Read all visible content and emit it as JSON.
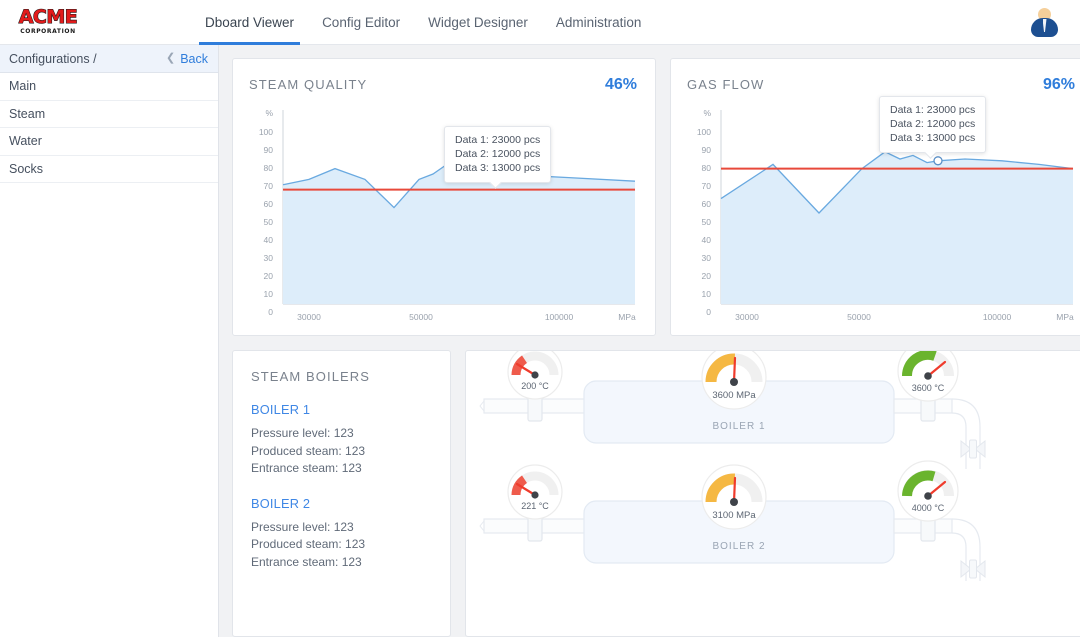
{
  "header": {
    "logo": {
      "brand": "ACME",
      "sub": "CORPORATION",
      "icon": "acme-logo-icon"
    },
    "nav": [
      {
        "label": "Dboard Viewer",
        "active": true
      },
      {
        "label": "Config Editor",
        "active": false
      },
      {
        "label": "Widget Designer",
        "active": false
      },
      {
        "label": "Administration",
        "active": false
      }
    ],
    "avatar_icon": "user-avatar-icon"
  },
  "sidebar": {
    "title": "Configurations /",
    "back_label": "Back",
    "back_icon": "chevron-left-icon",
    "items": [
      {
        "label": "Main"
      },
      {
        "label": "Steam"
      },
      {
        "label": "Water"
      },
      {
        "label": "Socks"
      }
    ]
  },
  "charts": [
    {
      "title": "STEAM QUALITY",
      "badge": "46%",
      "tooltip": [
        "Data 1: 23000 pcs",
        "Data 2: 12000 pcs",
        "Data 3: 13000 pcs"
      ]
    },
    {
      "title": "GAS FLOW",
      "badge": "96%",
      "tooltip": [
        "Data 1: 23000 pcs",
        "Data 2: 12000 pcs",
        "Data 3: 13000 pcs"
      ]
    }
  ],
  "boilers_panel": {
    "title": "STEAM BOILERS",
    "groups": [
      {
        "name": "BOILER 1",
        "stats": [
          "Pressure level: 123",
          "Produced steam: 123",
          "Entrance steam: 123"
        ]
      },
      {
        "name": "BOILER 2",
        "stats": [
          "Pressure level: 123",
          "Produced steam: 123",
          "Entrance steam: 123"
        ]
      }
    ]
  },
  "schematic": {
    "rows": [
      {
        "vessel_label": "BOILER 1",
        "gauges": [
          {
            "value": "200 °C",
            "color": "#ef5b4c",
            "angle": -52,
            "name": "inlet-temperature-gauge"
          },
          {
            "value": "3600 MPa",
            "color": "#f5b843",
            "angle": 2,
            "name": "pressure-gauge"
          },
          {
            "value": "3600 °C",
            "color": "#6ab42e",
            "angle": 52,
            "name": "outlet-temperature-gauge"
          }
        ]
      },
      {
        "vessel_label": "BOILER 2",
        "gauges": [
          {
            "value": "221 °C",
            "color": "#ef5b4c",
            "angle": -52,
            "name": "inlet-temperature-gauge"
          },
          {
            "value": "3100 MPa",
            "color": "#f5b843",
            "angle": 2,
            "name": "pressure-gauge"
          },
          {
            "value": "4000 °C",
            "color": "#6ab42e",
            "angle": 48,
            "name": "outlet-temperature-gauge"
          }
        ]
      }
    ]
  },
  "chart_data": [
    {
      "type": "area",
      "title": "STEAM QUALITY",
      "xlabel": "MPa",
      "ylabel": "%",
      "ylim": [
        0,
        105
      ],
      "xlim": [
        20000,
        115000
      ],
      "yticks": [
        0,
        10,
        20,
        30,
        40,
        50,
        60,
        70,
        80,
        90,
        100
      ],
      "xticks": [
        30000,
        50000,
        100000
      ],
      "grid": false,
      "threshold": 68,
      "threshold_color": "#e8493a",
      "line_color": "#69a9e0",
      "fill_color": "#ddedfa",
      "marker": {
        "x": 80000,
        "y": 69,
        "label": "Data 1: 23000 pcs"
      },
      "x": [
        22000,
        30000,
        38000,
        47000,
        55000,
        62000,
        66000,
        70000,
        73000,
        76000,
        80000,
        86000,
        95000,
        105000,
        114000
      ],
      "values": [
        64,
        67,
        73,
        67,
        58,
        67,
        70,
        75,
        71,
        73,
        69,
        70,
        69,
        68,
        66
      ]
    },
    {
      "type": "area",
      "title": "GAS FLOW",
      "xlabel": "MPa",
      "ylabel": "%",
      "ylim": [
        0,
        105
      ],
      "xlim": [
        20000,
        115000
      ],
      "yticks": [
        0,
        10,
        20,
        30,
        40,
        50,
        60,
        70,
        80,
        90,
        100
      ],
      "xticks": [
        30000,
        50000,
        100000
      ],
      "grid": false,
      "threshold": 80,
      "threshold_color": "#e8493a",
      "line_color": "#69a9e0",
      "fill_color": "#ddedfa",
      "marker": {
        "x": 80000,
        "y": 84,
        "label": "Data 1: 23000 pcs"
      },
      "x": [
        22000,
        36000,
        48000,
        58000,
        64000,
        68000,
        72000,
        76000,
        80000,
        86000,
        96000,
        106000,
        114000
      ],
      "values": [
        63,
        82,
        55,
        80,
        89,
        85,
        87,
        83,
        84,
        85,
        84,
        82,
        80
      ]
    }
  ]
}
